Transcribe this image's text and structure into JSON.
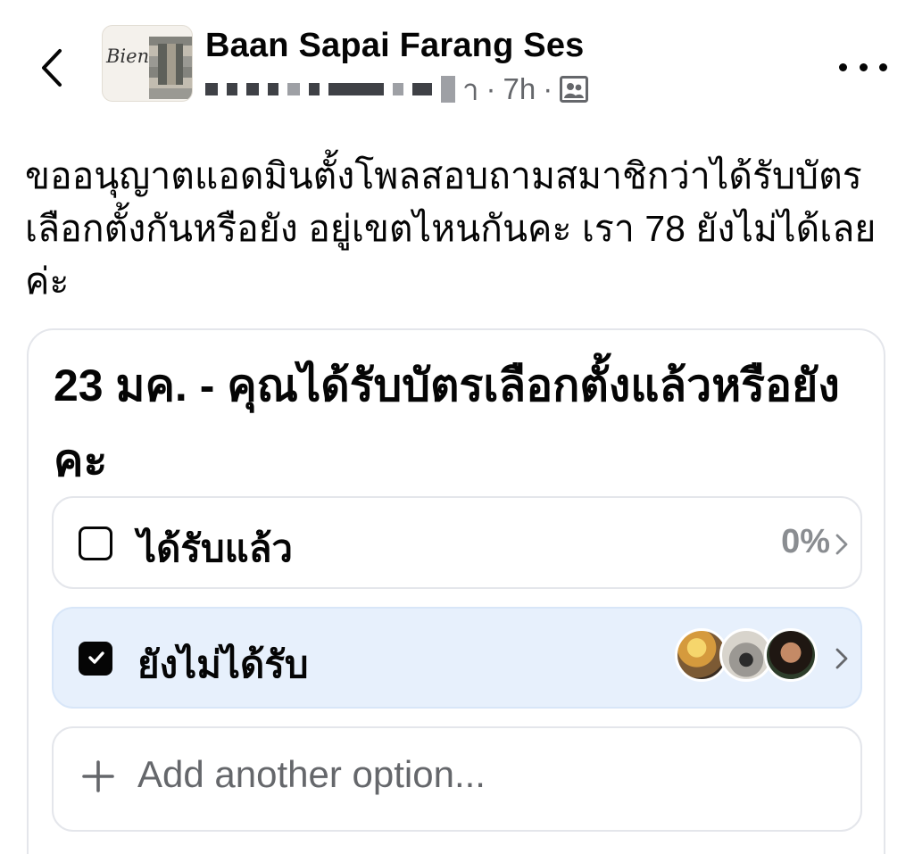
{
  "header": {
    "back_icon": "chevron-left-icon",
    "group_name": "Baan Sapai Farang Ses",
    "avatar_logo_text": "Bien",
    "meta": {
      "redacted_author": "██ ███ █ ██ ██",
      "author_suffix": "า",
      "time": "7h",
      "separator": "·",
      "audience_icon": "group-members-icon"
    },
    "more_icon": "more-horizontal-icon"
  },
  "post": {
    "text": "ขออนุญาตแอดมินตั้งโพลสอบถามสมาชิกว่าได้รับบัตรเลือกตั้งกันหรือยัง อยู่เขตไหนกันคะ เรา 78 ยังไม่ได้เลยค่ะ"
  },
  "poll": {
    "question": "23 มค. - คุณได้รับบัตรเลือกตั้งแล้วหรือยังคะ",
    "options": [
      {
        "label": "ได้รับแล้ว",
        "checked": false,
        "percent": "0%"
      },
      {
        "label": "ยังไม่ได้รับ",
        "checked": true,
        "voters_shown": 3
      }
    ],
    "add_option_plus": "+",
    "add_option_label": "Add another option..."
  },
  "colors": {
    "text": "#050505",
    "secondary": "#65676b",
    "selected_option_bg": "#e7f0fc",
    "border": "#e4e6eb"
  }
}
